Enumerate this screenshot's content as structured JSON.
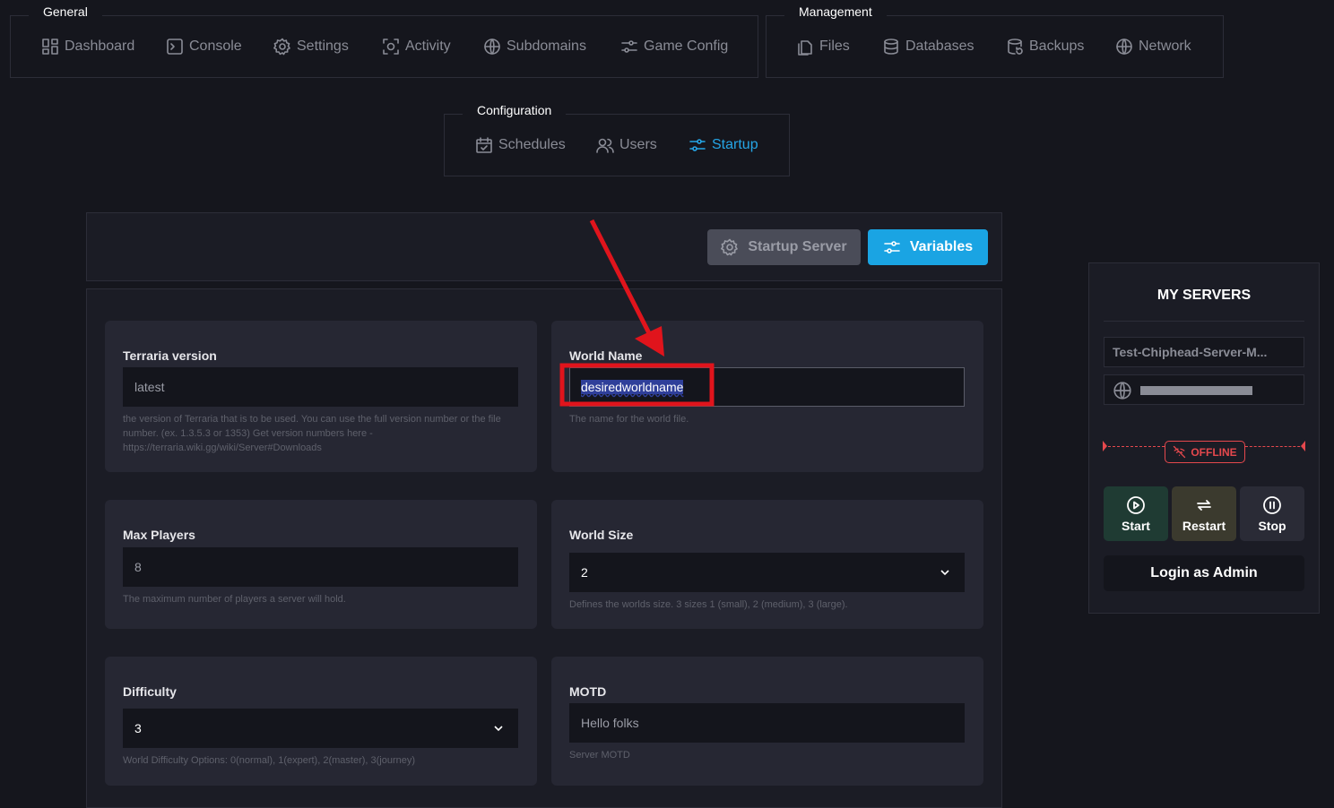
{
  "nav": {
    "general": {
      "title": "General",
      "items": [
        {
          "label": "Dashboard",
          "icon": "dashboard-icon"
        },
        {
          "label": "Console",
          "icon": "console-icon"
        },
        {
          "label": "Settings",
          "icon": "gear-icon"
        },
        {
          "label": "Activity",
          "icon": "activity-icon"
        },
        {
          "label": "Subdomains",
          "icon": "globe-icon"
        },
        {
          "label": "Game Config",
          "icon": "sliders-icon"
        }
      ]
    },
    "management": {
      "title": "Management",
      "items": [
        {
          "label": "Files",
          "icon": "files-icon"
        },
        {
          "label": "Databases",
          "icon": "database-icon"
        },
        {
          "label": "Backups",
          "icon": "backup-icon"
        },
        {
          "label": "Network",
          "icon": "globe-icon"
        }
      ]
    },
    "configuration": {
      "title": "Configuration",
      "items": [
        {
          "label": "Schedules",
          "icon": "calendar-icon"
        },
        {
          "label": "Users",
          "icon": "users-icon"
        },
        {
          "label": "Startup",
          "icon": "sliders-icon",
          "active": true
        }
      ]
    }
  },
  "toolbar": {
    "startup_server_label": "Startup Server",
    "variables_label": "Variables"
  },
  "variables": [
    {
      "label": "Terraria version",
      "value": "latest",
      "help": "the version of Terraria that is to be used. You can use the full version number or the file number. (ex. 1.3.5.3 or 1353) Get version numbers here - https://terraria.wiki.gg/wiki/Server#Downloads",
      "type": "text"
    },
    {
      "label": "World Name",
      "value": "desiredworldname",
      "help": "The name for the world file.",
      "type": "text",
      "selected": true
    },
    {
      "label": "Max Players",
      "value": "8",
      "help": "The maximum number of players a server will hold.",
      "type": "text"
    },
    {
      "label": "World Size",
      "value": "2",
      "help": "Defines the worlds size. 3 sizes 1 (small), 2 (medium), 3 (large).",
      "type": "select"
    },
    {
      "label": "Difficulty",
      "value": "3",
      "help": "World Difficulty Options: 0(normal), 1(expert), 2(master), 3(journey)",
      "type": "select"
    },
    {
      "label": "MOTD",
      "value": "Hello folks",
      "help": "Server MOTD",
      "type": "text"
    }
  ],
  "sidebar": {
    "title": "MY SERVERS",
    "server_name": "Test-Chiphead-Server-M...",
    "status": "OFFLINE",
    "controls": {
      "start": "Start",
      "restart": "Restart",
      "stop": "Stop"
    },
    "login_admin": "Login as Admin"
  },
  "colors": {
    "accent": "#25a5e6",
    "offline": "#e5484d",
    "annotation": "#e0141c",
    "start_bg": "#1f3b33",
    "restart_bg": "#3b3a2e"
  }
}
